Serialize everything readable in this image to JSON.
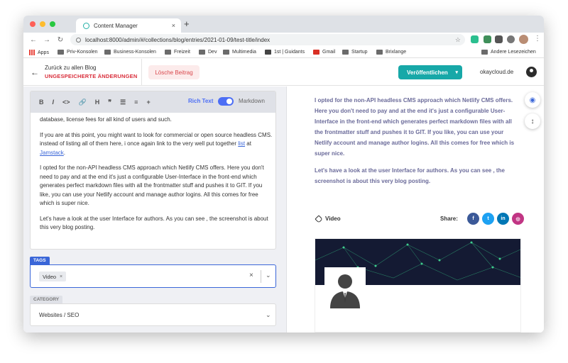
{
  "browser": {
    "tab_title": "Content Manager",
    "new_tab": "+",
    "close": "×",
    "url": "localhost:8000/admin/#/collections/blog/entries/2021-01-09/test-title/index",
    "nav_back": "←",
    "nav_forward": "→",
    "reload": "↻",
    "star": "☆",
    "menu": "⋮",
    "bookmarks": [
      {
        "label": "Apps",
        "icon": "apps-grid-icon"
      },
      {
        "label": "Priv-Konsolen",
        "icon": "folder-icon"
      },
      {
        "label": "Business-Konsolen",
        "icon": "folder-icon"
      },
      {
        "label": "Freizeit",
        "icon": "folder-icon"
      },
      {
        "label": "Dev",
        "icon": "folder-icon"
      },
      {
        "label": "Multimedia",
        "icon": "folder-icon"
      },
      {
        "label": "1st | Guidants",
        "icon": "guidants-icon"
      },
      {
        "label": "Gmail",
        "icon": "gmail-icon"
      },
      {
        "label": "Startup",
        "icon": "folder-icon"
      },
      {
        "label": "Brixlange",
        "icon": "folder-icon"
      }
    ],
    "other_bookmarks": "Andere Lesezeichen"
  },
  "header": {
    "back_icon": "←",
    "back_title": "Zurück zu allen Blog",
    "unsaved": "UNGESPEICHERTE ÄNDERUNGEN",
    "delete_label": "Lösche Beitrag",
    "publish_label": "Veröffentlichen",
    "publish_caret": "▾",
    "site": "okaycloud.de"
  },
  "editor": {
    "toolbar": [
      "B",
      "I",
      "<>",
      "🔗",
      "H",
      "❞",
      "☰",
      "≡",
      "+"
    ],
    "rich_text_label": "Rich Text",
    "markdown_label": "Markdown",
    "p1": "database, license fees for all kind of users and such.",
    "p2_a": "If you are at this point, you might want to look for commercial or open source headless CMS. instead of listing all of them here, i once again link to the very well put together ",
    "p2_link1": "list",
    "p2_mid": " at ",
    "p2_link2": "Jamstack",
    "p2_end": ".",
    "p3": "I opted for the non-API headless CMS approach which Netlify CMS offers. Here you don't need to pay and at the end it's just a configurable User-Interface in the front-end which generates perfect markdown files with all the frontmatter stuff and pushes it to GIT. If you like, you can use your Netlify account and manage author logins. All this comes for free which is super nice.",
    "p4": "Let's have a look at the user Interface for authors. As you can see , the screenshot is about this very blog posting."
  },
  "tags": {
    "label": "TAGS",
    "chip": "Video",
    "chip_remove": "×",
    "clear": "×",
    "chevron": "⌄"
  },
  "category": {
    "label": "CATEGORY",
    "value": "Websites / SEO",
    "chevron": "⌄"
  },
  "preview": {
    "p1": "I opted for the non-API headless CMS approach which Netlify CMS offers. Here you don't need to pay and at the end it's just a configurable User-Interface in the front-end which generates perfect markdown files with all the frontmatter stuff and pushes it to GIT. If you like, you can use your Netlify account and manage author logins. All this comes for free which is super nice.",
    "p2": "Let's have a look at the user Interface for authors. As you can see , the screenshot is about this very blog posting.",
    "tag": "Video",
    "share_label": "Share:",
    "social": [
      {
        "glyph": "f",
        "icon": "facebook-icon",
        "color": "#3b5998"
      },
      {
        "glyph": "t",
        "icon": "twitter-icon",
        "color": "#1da1f2"
      },
      {
        "glyph": "in",
        "icon": "linkedin-icon",
        "color": "#0077b5"
      },
      {
        "glyph": "◎",
        "icon": "instagram-icon",
        "color": "#c13584"
      }
    ]
  },
  "colors": {
    "accent": "#17a8a8",
    "link": "#3a66d8",
    "danger": "#d92d3a"
  }
}
